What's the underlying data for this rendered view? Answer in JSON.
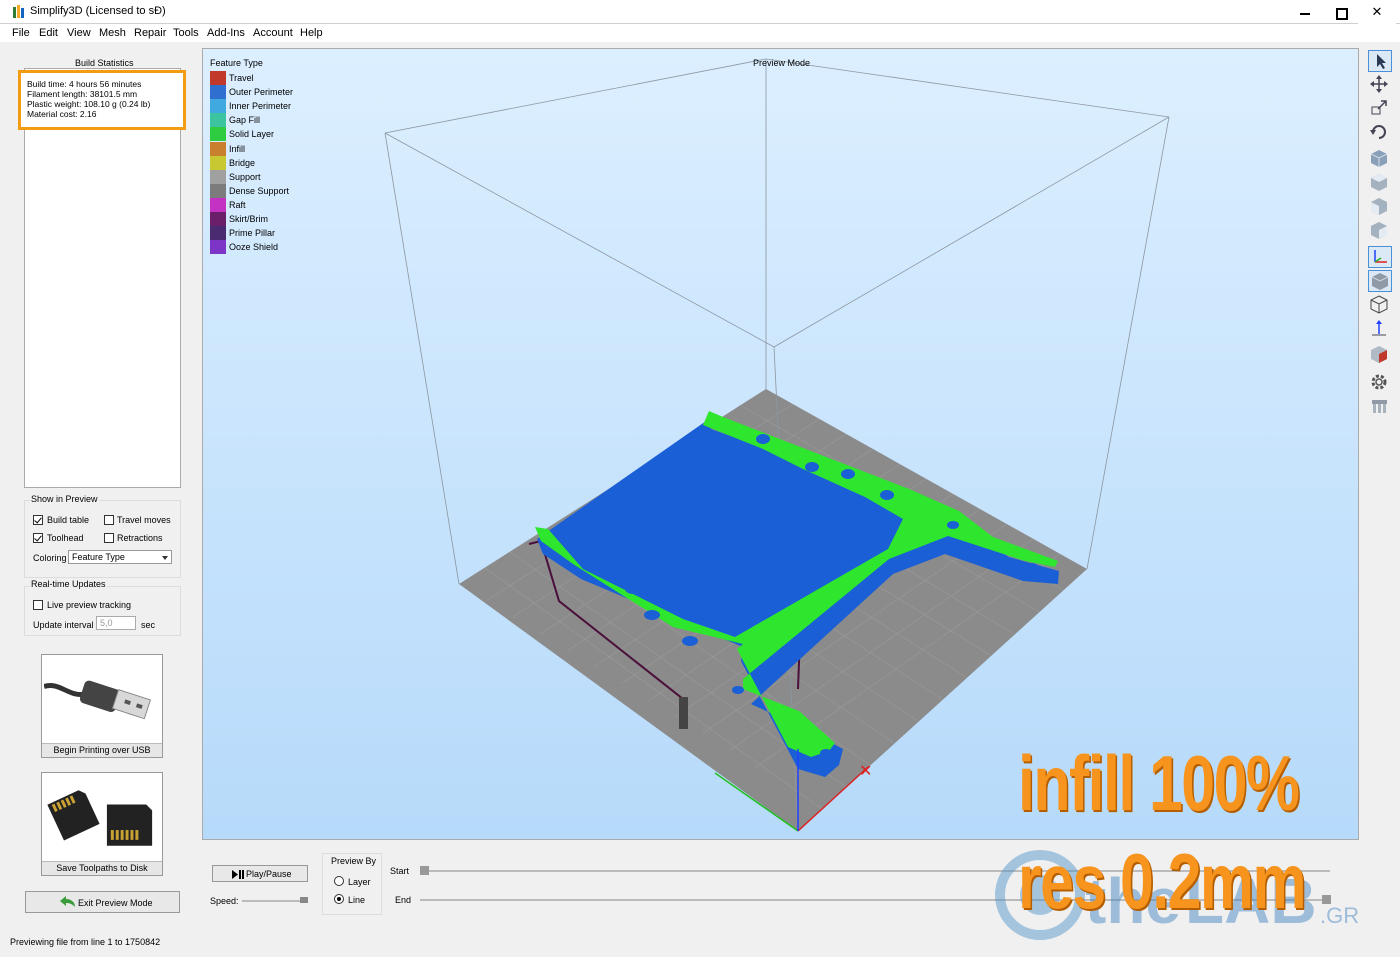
{
  "window": {
    "title": "Simplify3D (Licensed to sĐ)"
  },
  "menu": [
    "File",
    "Edit",
    "View",
    "Mesh",
    "Repair",
    "Tools",
    "Add-Ins",
    "Account",
    "Help"
  ],
  "build_statistics": {
    "title": "Build Statistics",
    "lines": [
      "Build time: 4 hours 56 minutes",
      "Filament length: 38101.5 mm",
      "Plastic weight: 108.10 g (0.24 lb)",
      "Material cost: 2.16"
    ]
  },
  "show_in_preview": {
    "title": "Show in Preview",
    "build_table": {
      "label": "Build table",
      "checked": true
    },
    "travel_moves": {
      "label": "Travel moves",
      "checked": false
    },
    "toolhead": {
      "label": "Toolhead",
      "checked": true
    },
    "retractions": {
      "label": "Retractions",
      "checked": false
    },
    "coloring_label": "Coloring",
    "coloring_value": "Feature Type"
  },
  "realtime": {
    "title": "Real-time Updates",
    "live_tracking": {
      "label": "Live preview tracking",
      "checked": false
    },
    "interval_label": "Update interval",
    "interval_value": "5,0",
    "interval_unit": "sec"
  },
  "actions": {
    "usb_label": "Begin Printing over USB",
    "disk_label": "Save Toolpaths to Disk",
    "exit_label": "Exit Preview Mode"
  },
  "viewport": {
    "mode_title": "Preview Mode",
    "legend_title": "Feature Type",
    "legend": [
      {
        "name": "Travel",
        "color": "#c0392b"
      },
      {
        "name": "Outer Perimeter",
        "color": "#2e6fd0"
      },
      {
        "name": "Inner Perimeter",
        "color": "#3fa9e0"
      },
      {
        "name": "Gap Fill",
        "color": "#3cc4a0"
      },
      {
        "name": "Solid Layer",
        "color": "#2ecc40"
      },
      {
        "name": "Infill",
        "color": "#c87f2e"
      },
      {
        "name": "Bridge",
        "color": "#c8c832"
      },
      {
        "name": "Support",
        "color": "#a0a0a0"
      },
      {
        "name": "Dense Support",
        "color": "#7c7c7c"
      },
      {
        "name": "Raft",
        "color": "#c432c4"
      },
      {
        "name": "Skirt/Brim",
        "color": "#6a1f6a"
      },
      {
        "name": "Prime Pillar",
        "color": "#4a2a70"
      },
      {
        "name": "Ooze Shield",
        "color": "#7d35c8"
      }
    ]
  },
  "playback": {
    "play_label": "Play/Pause",
    "speed_label": "Speed:",
    "preview_by_title": "Preview By",
    "layer_label": "Layer",
    "line_label": "Line",
    "line_selected": true,
    "start_label": "Start",
    "end_label": "End"
  },
  "status": "Previewing file from line 1 to 1750842",
  "overlay": {
    "line1": "infill 100%",
    "line2": "res 0.2mm"
  },
  "watermark": {
    "text": "the",
    "text2": "LAB",
    "suffix": ".GR"
  },
  "colors": {
    "accent_orange": "#f39c12",
    "part_green": "#2ee62e",
    "part_blue": "#1a5fd6",
    "bed_gray": "#8a8a8a"
  }
}
